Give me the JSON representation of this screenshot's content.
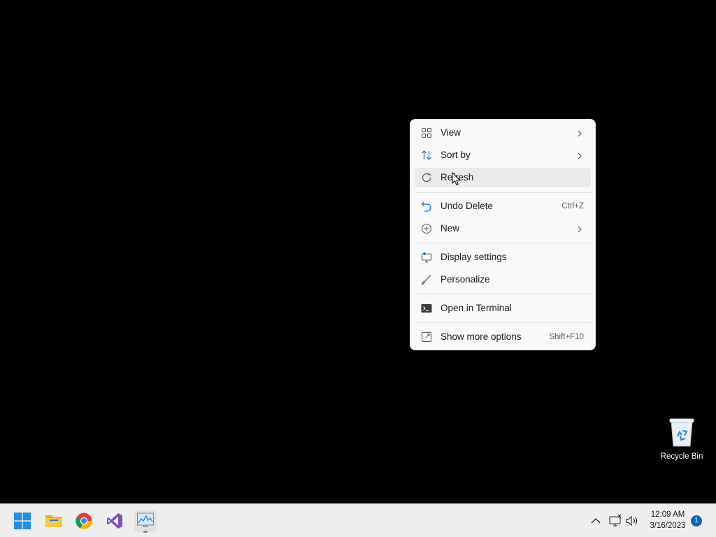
{
  "context_menu": {
    "items": [
      {
        "label": "View",
        "icon": "view-grid-icon",
        "submenu": true
      },
      {
        "label": "Sort by",
        "icon": "sort-icon",
        "submenu": true
      },
      {
        "label": "Refresh",
        "icon": "refresh-icon",
        "hovered": true
      },
      {
        "label": "Undo Delete",
        "icon": "undo-icon",
        "shortcut": "Ctrl+Z"
      },
      {
        "label": "New",
        "icon": "new-icon",
        "submenu": true
      },
      {
        "label": "Display settings",
        "icon": "display-settings-icon"
      },
      {
        "label": "Personalize",
        "icon": "personalize-icon"
      },
      {
        "label": "Open in Terminal",
        "icon": "terminal-icon"
      },
      {
        "label": "Show more options",
        "icon": "more-options-icon",
        "shortcut": "Shift+F10"
      }
    ]
  },
  "desktop": {
    "recycle_bin_label": "Recycle Bin"
  },
  "taskbar": {
    "apps": [
      {
        "name": "Start",
        "icon": "windows-start-icon"
      },
      {
        "name": "File Explorer",
        "icon": "file-explorer-icon"
      },
      {
        "name": "Google Chrome",
        "icon": "chrome-icon"
      },
      {
        "name": "Visual Studio",
        "icon": "visual-studio-icon"
      },
      {
        "name": "Performance Monitor",
        "icon": "performance-monitor-icon",
        "running": true
      }
    ],
    "tray": {
      "time": "12:09 AM",
      "date": "3/16/2023",
      "notification_count": "1"
    }
  },
  "colors": {
    "accent": "#0a64c8",
    "menu_background": "#f9f9f9",
    "hover": "#ebebeb",
    "taskbar": "#eeeeee"
  }
}
